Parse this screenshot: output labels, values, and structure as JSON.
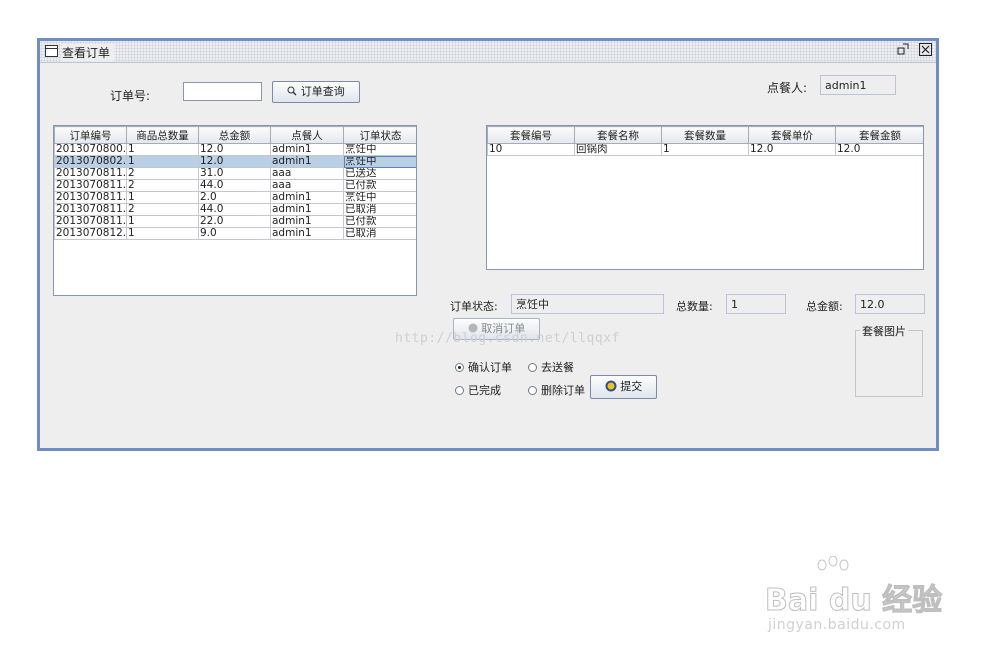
{
  "window": {
    "title": "查看订单",
    "min_glyph": "ㅁ",
    "close_glyph": "☒"
  },
  "search": {
    "label": "订单号:",
    "value": "",
    "button_label": "订单查询",
    "button_icon": "search-icon"
  },
  "user": {
    "label": "点餐人:",
    "value": "admin1"
  },
  "orders": {
    "columns": [
      "订单编号",
      "商品总数量",
      "总金额",
      "点餐人",
      "订单状态"
    ],
    "rows": [
      [
        "2013070800...",
        "1",
        "12.0",
        "admin1",
        "烹饪中"
      ],
      [
        "2013070802...",
        "1",
        "12.0",
        "admin1",
        "烹饪中"
      ],
      [
        "2013070811...",
        "2",
        "31.0",
        "aaa",
        "已送达"
      ],
      [
        "2013070811...",
        "2",
        "44.0",
        "aaa",
        "已付款"
      ],
      [
        "2013070811...",
        "1",
        "2.0",
        "admin1",
        "烹饪中"
      ],
      [
        "2013070811...",
        "2",
        "44.0",
        "admin1",
        "已取消"
      ],
      [
        "2013070811...",
        "1",
        "22.0",
        "admin1",
        "已付款"
      ],
      [
        "2013070812...",
        "1",
        "9.0",
        "admin1",
        "已取消"
      ]
    ],
    "selected_row": 1
  },
  "packages": {
    "columns": [
      "套餐编号",
      "套餐名称",
      "套餐数量",
      "套餐单价",
      "套餐金额"
    ],
    "rows": [
      [
        "10",
        "回锅肉",
        "1",
        "12.0",
        "12.0"
      ]
    ]
  },
  "status": {
    "label": "订单状态:",
    "value": "烹饪中"
  },
  "total_count": {
    "label": "总数量:",
    "value": "1"
  },
  "total_amount": {
    "label": "总金额:",
    "value": "12.0"
  },
  "cancel_button": "取消订单",
  "image_group_label": "套餐图片",
  "actions": {
    "confirm": "确认订单",
    "deliver": "去送餐",
    "complete": "已完成",
    "delete": "删除订单",
    "selected": "confirm"
  },
  "submit_button": "提交",
  "watermark": "http://blog.csdn.net/llqqxf",
  "baidu": {
    "logo": "Bai du 经验",
    "site": "jingyan.baidu.com"
  }
}
